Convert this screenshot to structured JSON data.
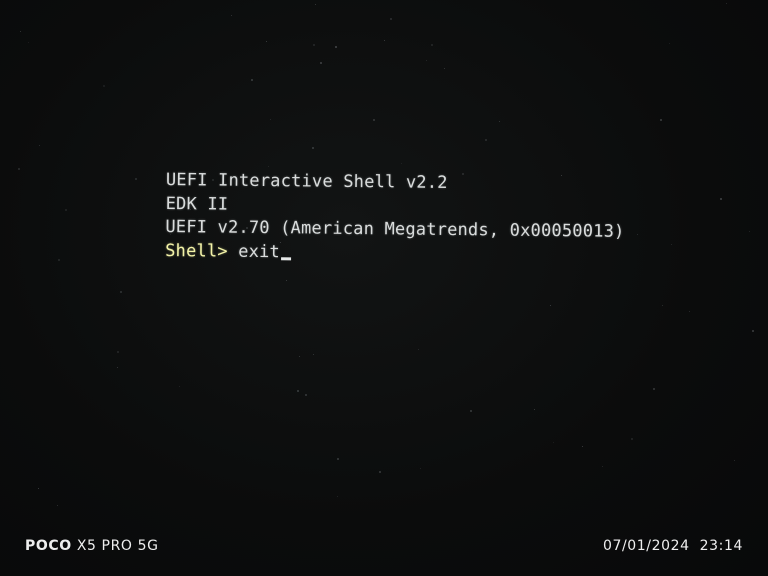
{
  "shell": {
    "lines": [
      "UEFI Interactive Shell v2.2",
      "EDK II",
      "UEFI v2.70 (American Megatrends, 0x00050013)"
    ],
    "prompt": "Shell>",
    "command": "exit"
  },
  "watermark": {
    "brand": "POCO",
    "model": "X5 PRO 5G",
    "date": "07/01/2024",
    "time": "23:14"
  },
  "colors": {
    "background": "#0c0d0d",
    "text": "#d9dcdc",
    "prompt": "#f3f3a8"
  }
}
